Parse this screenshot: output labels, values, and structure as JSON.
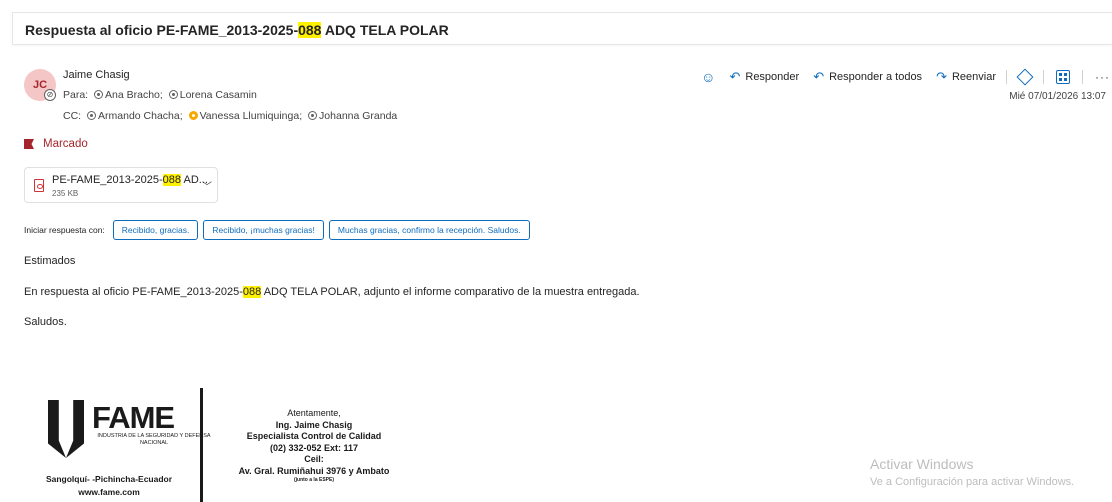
{
  "subject": {
    "prefix": "Respuesta al oficio PE-FAME_2013-2025-",
    "highlight": "088",
    "suffix": " ADQ TELA POLAR"
  },
  "sender": {
    "initials": "JC",
    "name": "Jaime Chasig",
    "to_label": "Para:",
    "to": [
      "Ana Bracho;",
      "Lorena Casamin"
    ],
    "cc_label": "CC:",
    "cc": [
      "Armando Chacha;",
      "Vanessa Llumiquinga;",
      "Johanna Granda"
    ]
  },
  "toolbar": {
    "reply": "Responder",
    "reply_all": "Responder a todos",
    "forward": "Reenviar",
    "icons": [
      "emoji-icon",
      "reply-icon",
      "reply-all-icon",
      "forward-icon",
      "loop-icon",
      "apps-icon",
      "more-icon"
    ]
  },
  "date": "Mié 07/01/2026 13:07",
  "flag": "Marcado",
  "attachment": {
    "name_prefix": "PE-FAME_2013-2025-",
    "name_highlight": "088",
    "name_suffix": " AD...",
    "size": "235 KB"
  },
  "quick_reply": {
    "label": "Iniciar respuesta con:",
    "options": [
      "Recibido, gracias.",
      "Recibido, ¡muchas gracias!",
      "Muchas gracias, confirmo la recepción. Saludos."
    ]
  },
  "body": {
    "greeting": "Estimados",
    "line_prefix": "En respuesta al oficio PE-FAME_2013-2025-",
    "line_highlight": "088",
    "line_suffix": " ADQ TELA POLAR, adjunto el informe comparativo de la muestra entregada.",
    "closing": "Saludos."
  },
  "signature": {
    "logo_word": "FAME",
    "logo_sub": "INDUSTRIA DE LA SEGURIDAD Y DEFENSA NACIONAL",
    "location": "Sangolquí- -Pichincha-Ecuador",
    "website": "www.fame.com",
    "lines": [
      "Atentamente,",
      "Ing. Jaime Chasig",
      "Especialista Control de Calidad",
      "(02) 332-052 Ext: 117",
      "Ceil:",
      "Av. Gral. Rumiñahui 3976 y Ambato",
      "(junto a la ESPE)"
    ]
  },
  "watermark": {
    "title": "Activar Windows",
    "subtitle": "Ve a Configuración para activar Windows."
  }
}
